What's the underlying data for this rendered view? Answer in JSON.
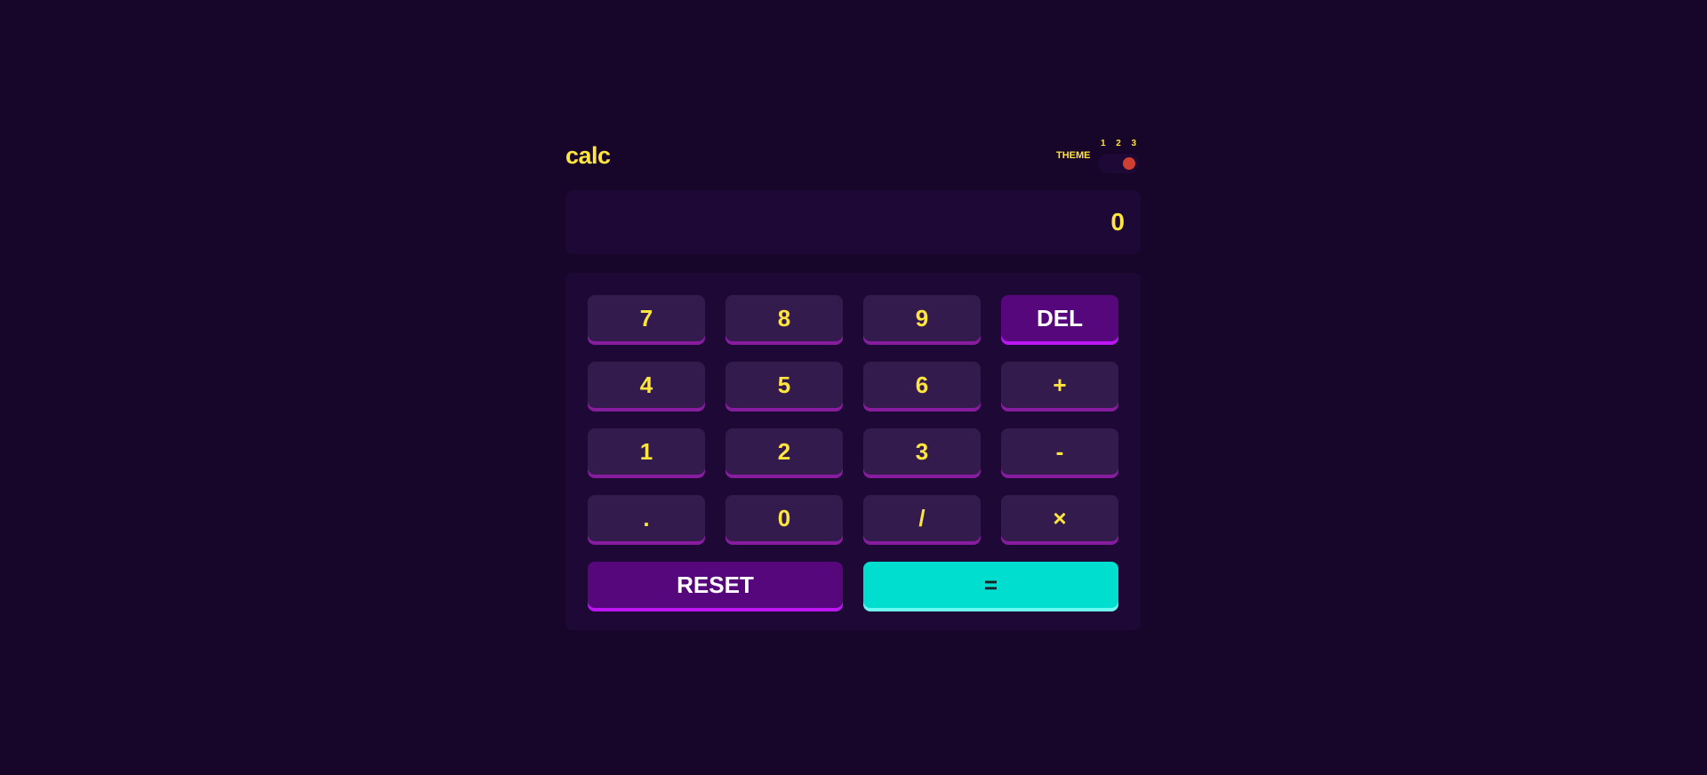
{
  "header": {
    "logo": "calc",
    "theme_label": "THEME",
    "theme_options": [
      "1",
      "2",
      "3"
    ],
    "selected_theme": 3
  },
  "display": {
    "value": "0"
  },
  "keys": [
    "7",
    "8",
    "9",
    "DEL",
    "4",
    "5",
    "6",
    "+",
    "1",
    "2",
    "3",
    "-",
    ".",
    "0",
    "/",
    "×",
    "RESET",
    "="
  ],
  "colors": {
    "background": "#17062a",
    "screen": "#1e0836",
    "key": "#331c4d",
    "key_text": "#ffe53d",
    "accent_key": "#56077c",
    "equals_key": "#00decf",
    "toggle_knob": "#d03f2f"
  }
}
